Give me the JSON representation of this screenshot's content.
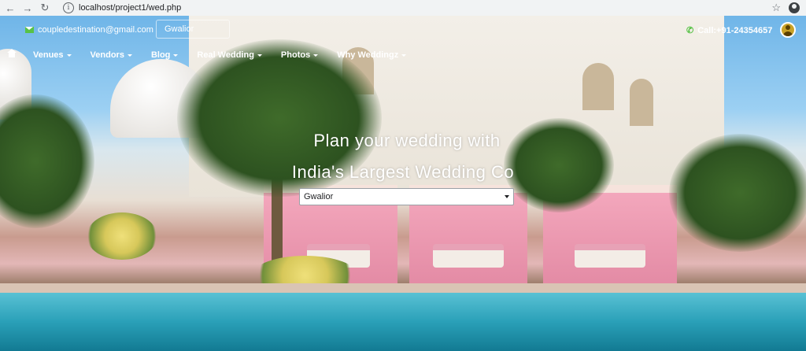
{
  "browser": {
    "url": "localhost/project1/wed.php"
  },
  "topbar": {
    "email": "coupledestination@gmail.com",
    "city": "Gwalior",
    "phone": "Call:+91-24354657"
  },
  "nav": {
    "items": [
      {
        "label": "Venues"
      },
      {
        "label": "Vendors"
      },
      {
        "label": "Blog"
      },
      {
        "label": "Real Wedding"
      },
      {
        "label": "Photos"
      },
      {
        "label": "Why Weddingz"
      }
    ]
  },
  "hero": {
    "headline_line1": "Plan your wedding with",
    "headline_line2": "India's Largest Wedding Co",
    "city_select_value": "Gwalior"
  },
  "colors": {
    "accent_green": "#58c247",
    "white": "#ffffff"
  }
}
